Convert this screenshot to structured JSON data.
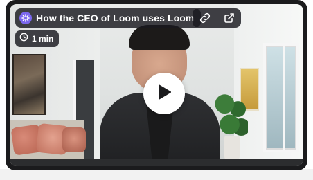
{
  "video": {
    "title": "How the CEO of Loom uses Loom",
    "duration": "1 min"
  },
  "icons": {
    "logo": "loom-logo-icon",
    "copy_link": "link-icon",
    "open_external": "external-link-icon",
    "duration": "clock-icon",
    "play": "play-icon"
  },
  "colors": {
    "brand": "#7b68ee",
    "overlay": "#19191e",
    "card": "#1b1b1d"
  }
}
